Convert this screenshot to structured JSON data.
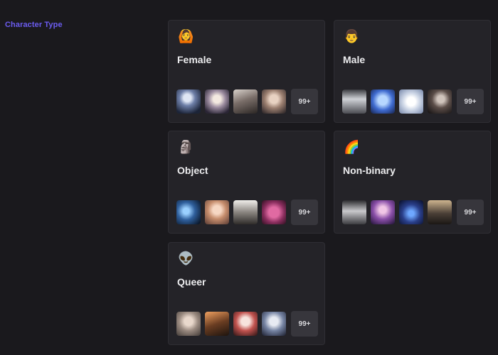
{
  "section": {
    "label": "Character Type"
  },
  "cards": [
    {
      "title": "Female",
      "emoji": "🙆",
      "more": "99+",
      "thumbs": [
        "t-a",
        "t-b",
        "t-c",
        "t-d"
      ]
    },
    {
      "title": "Male",
      "emoji": "👨",
      "more": "99+",
      "thumbs": [
        "t-e",
        "t-f",
        "t-g",
        "t-h"
      ]
    },
    {
      "title": "Object",
      "emoji": "🗿",
      "more": "99+",
      "thumbs": [
        "t-i",
        "t-j",
        "t-k",
        "t-l"
      ]
    },
    {
      "title": "Non-binary",
      "emoji": "🌈",
      "more": "99+",
      "thumbs": [
        "t-m",
        "t-n",
        "t-o",
        "t-p"
      ]
    },
    {
      "title": "Queer",
      "emoji": "👽",
      "more": "99+",
      "thumbs": [
        "t-q",
        "t-r",
        "t-s",
        "t-t"
      ]
    }
  ]
}
